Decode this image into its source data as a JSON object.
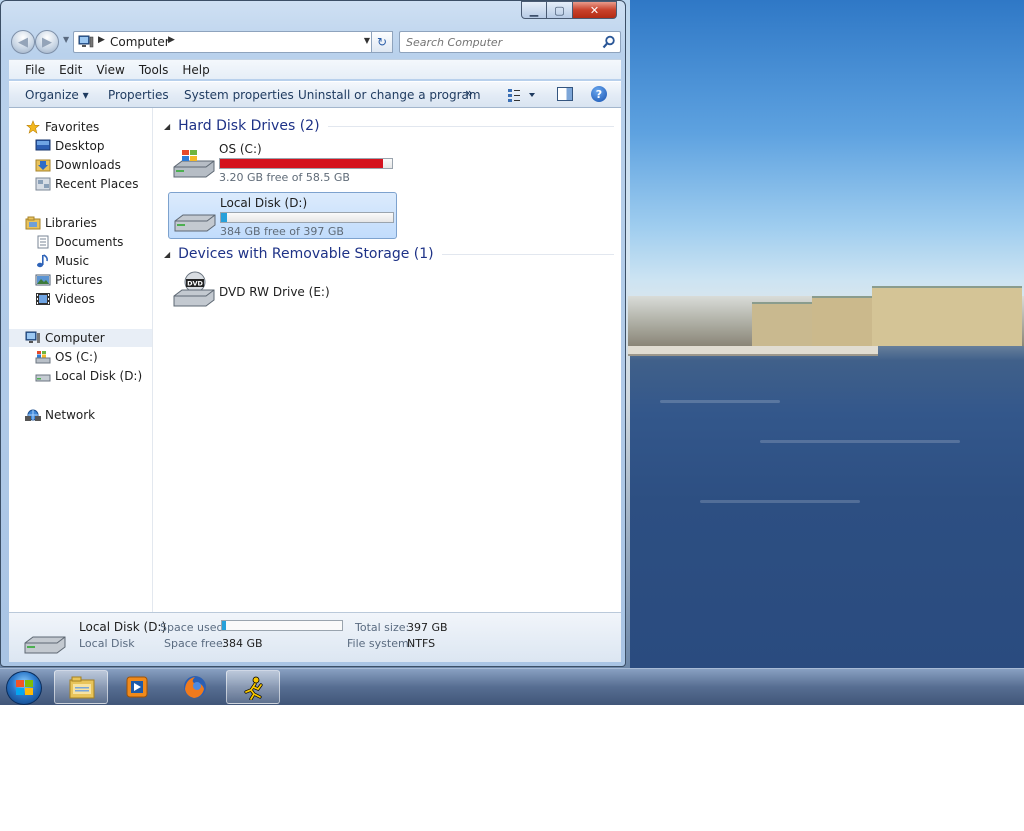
{
  "window": {
    "caption": {
      "minimize": "▁",
      "maximize": "▢",
      "close": "✕"
    }
  },
  "navbar": {
    "back_glyph": "◀",
    "forward_glyph": "▶",
    "breadcrumb": [
      "Computer"
    ],
    "search_placeholder": "Search Computer"
  },
  "menubar": {
    "items": [
      "File",
      "Edit",
      "View",
      "Tools",
      "Help"
    ]
  },
  "commandbar": {
    "organize": "Organize ▾",
    "properties": "Properties",
    "system_properties": "System properties",
    "uninstall": "Uninstall or change a program",
    "more": "»",
    "help": "?"
  },
  "navpane": {
    "favorites": {
      "label": "Favorites",
      "items": [
        "Desktop",
        "Downloads",
        "Recent Places"
      ]
    },
    "libraries": {
      "label": "Libraries",
      "items": [
        "Documents",
        "Music",
        "Pictures",
        "Videos"
      ]
    },
    "computer": {
      "label": "Computer",
      "items": [
        "OS (C:)",
        "Local Disk (D:)"
      ]
    },
    "network": {
      "label": "Network"
    }
  },
  "content": {
    "groups": [
      {
        "header": "Hard Disk Drives (2)",
        "drives": [
          {
            "name": "OS (C:)",
            "free_text": "3.20 GB free of 58.5 GB",
            "used_fraction": 0.945,
            "bar_color": "#d4121e"
          },
          {
            "name": "Local Disk (D:)",
            "free_text": "384 GB free of 397 GB",
            "used_fraction": 0.033,
            "bar_color": "#26a0da"
          }
        ]
      },
      {
        "header": "Devices with Removable Storage (1)",
        "devices": [
          {
            "name": "DVD RW Drive (E:)",
            "badge": "DVD"
          }
        ]
      }
    ]
  },
  "details": {
    "name": "Local Disk (D:)",
    "type": "Local Disk",
    "space_used_label": "Space used:",
    "space_used_fraction": 0.033,
    "space_free_label": "Space free:",
    "space_free": "384 GB",
    "total_size_label": "Total size:",
    "total_size": "397 GB",
    "file_system_label": "File system:",
    "file_system": "NTFS"
  },
  "taskbar": {
    "buttons": [
      "windows-explorer",
      "windows-media-player",
      "firefox",
      "aim"
    ]
  },
  "colors": {
    "accent_blue": "#1e3287",
    "low_space_red": "#d4121e",
    "ok_space_blue": "#26a0da"
  }
}
